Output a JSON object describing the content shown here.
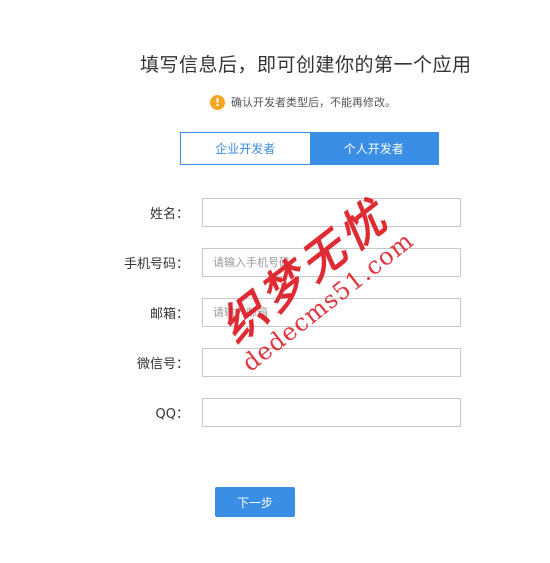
{
  "header": {
    "title": "填写信息后，即可创建你的第一个应用",
    "notice_icon": "!",
    "notice": "确认开发者类型后，不能再修改。"
  },
  "tabs": [
    {
      "label": "企业开发者",
      "active": false
    },
    {
      "label": "个人开发者",
      "active": true
    }
  ],
  "form": {
    "name": {
      "label": "姓名：",
      "value": "",
      "placeholder": ""
    },
    "phone": {
      "label": "手机号码：",
      "value": "",
      "placeholder": "请输入手机号码"
    },
    "email": {
      "label": "邮箱：",
      "value": "",
      "placeholder": "请输入邮箱"
    },
    "wechat": {
      "label": "微信号：",
      "value": "",
      "placeholder": ""
    },
    "qq": {
      "label": "QQ：",
      "value": "",
      "placeholder": ""
    }
  },
  "actions": {
    "next_label": "下一步"
  },
  "watermark": {
    "text": "织梦无忧",
    "url": "dedecms51.com"
  },
  "colors": {
    "accent": "#3a8ee6",
    "warning": "#f5a623",
    "watermark": "#dc141e"
  }
}
